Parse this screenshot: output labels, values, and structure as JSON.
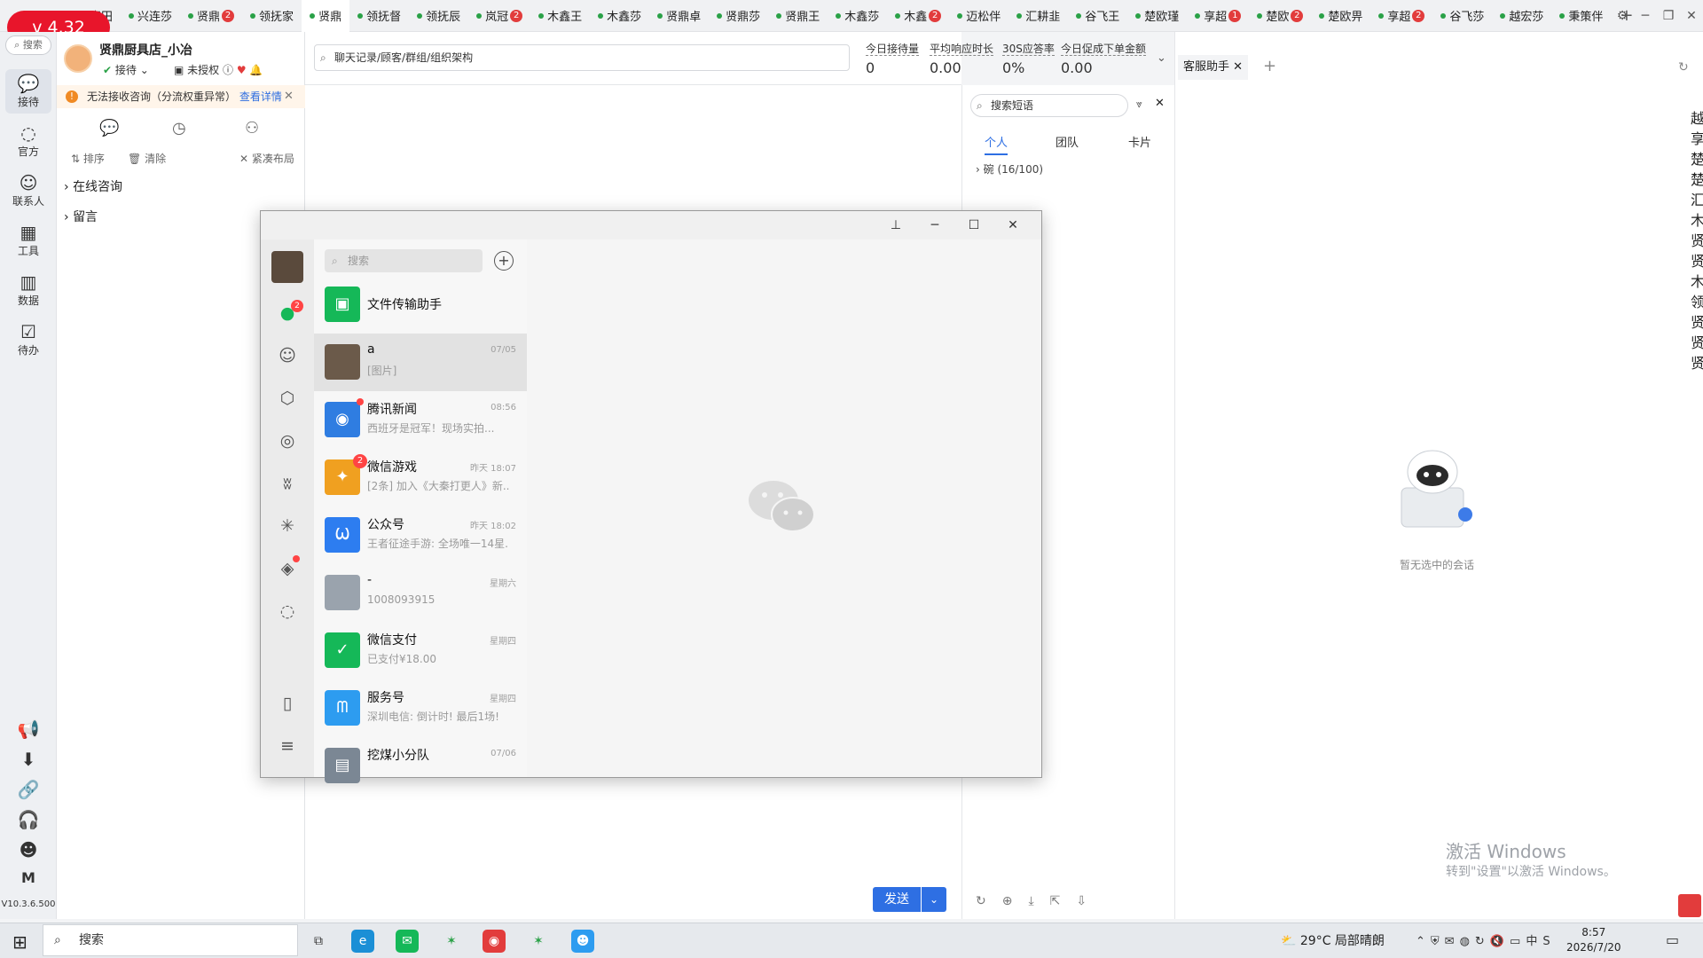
{
  "app": {
    "version_badge": "v 4.32",
    "rail_version": "V10.3.6.500"
  },
  "tabs": [
    {
      "label": "喜田",
      "badge": "",
      "active": false
    },
    {
      "label": "兴连莎",
      "badge": "",
      "active": false
    },
    {
      "label": "贤鼎",
      "badge": "2",
      "active": false
    },
    {
      "label": "领抚家",
      "badge": "",
      "active": false
    },
    {
      "label": "贤鼎",
      "badge": "",
      "active": true
    },
    {
      "label": "领抚督",
      "badge": "",
      "active": false
    },
    {
      "label": "领抚辰",
      "badge": "",
      "active": false
    },
    {
      "label": "岚冠",
      "badge": "2",
      "active": false
    },
    {
      "label": "木鑫王",
      "badge": "",
      "active": false
    },
    {
      "label": "木鑫莎",
      "badge": "",
      "active": false
    },
    {
      "label": "贤鼎卓",
      "badge": "",
      "active": false
    },
    {
      "label": "贤鼎莎",
      "badge": "",
      "active": false
    },
    {
      "label": "贤鼎王",
      "badge": "",
      "active": false
    },
    {
      "label": "木鑫莎",
      "badge": "",
      "active": false
    },
    {
      "label": "木鑫",
      "badge": "2",
      "active": false
    },
    {
      "label": "迈松伴",
      "badge": "",
      "active": false
    },
    {
      "label": "汇耕韭",
      "badge": "",
      "active": false
    },
    {
      "label": "谷飞王",
      "badge": "",
      "active": false
    },
    {
      "label": "楚欧瑾",
      "badge": "",
      "active": false
    },
    {
      "label": "享超",
      "badge": "1",
      "active": false
    },
    {
      "label": "楚欧",
      "badge": "2",
      "active": false
    },
    {
      "label": "楚欧畀",
      "badge": "",
      "active": false
    },
    {
      "label": "享超",
      "badge": "2",
      "active": false
    },
    {
      "label": "谷飞莎",
      "badge": "",
      "active": false
    },
    {
      "label": "越宏莎",
      "badge": "",
      "active": false
    },
    {
      "label": "秉策伴",
      "badge": "",
      "active": false
    }
  ],
  "rail": {
    "search": "搜索",
    "items": [
      "接待",
      "官方",
      "联系人",
      "工具",
      "数据",
      "待办"
    ]
  },
  "left_panel": {
    "shop_name": "贤鼎厨具店_小冶",
    "status": "接待",
    "auth": "未授权",
    "warning": "无法接收咨询（分流权重异常）",
    "warning_link": "查看详情",
    "sort": "排序",
    "clear": "清除",
    "compact": "紧凑布局",
    "groups": [
      "在线咨询",
      "留言"
    ]
  },
  "center": {
    "search_placeholder": "聊天记录/顾客/群组/组织架构",
    "kpis": [
      {
        "label": "今日接待量",
        "value": "0"
      },
      {
        "label": "平均响应时长",
        "value": "0.00"
      },
      {
        "label": "30S应答率",
        "value": "0%"
      },
      {
        "label": "今日促成下单金额",
        "value": "0.00"
      }
    ],
    "send": "发送"
  },
  "phrases": {
    "search_placeholder": "搜索短语",
    "tabs": [
      "个人",
      "团队",
      "卡片"
    ],
    "group": "碗 (16/100)"
  },
  "assistant": {
    "tab": "客服助手",
    "empty": "暂无选中的会话",
    "activate_title": "激活 Windows",
    "activate_sub": "转到\"设置\"以激活 Windows。",
    "right_chars": [
      "越",
      "享",
      "楚",
      "楚",
      "汇",
      "木",
      "贤",
      "贤",
      "木",
      "领",
      "贤",
      "贤",
      "贤"
    ]
  },
  "wechat": {
    "search": "搜索",
    "chat_badge": "2",
    "chats": [
      {
        "name": "文件传输助手",
        "time": "",
        "preview": "",
        "badge": "",
        "color": "#15b858",
        "icon": "folder-icon"
      },
      {
        "name": "a",
        "time": "07/05",
        "preview": "[图片]",
        "badge": "",
        "color": "#6b5a4a",
        "icon": "avatar-photo"
      },
      {
        "name": "腾讯新闻",
        "time": "08:56",
        "preview": "西班牙是冠军！现场实拍...",
        "badge": "dot",
        "color": "#2f7de1",
        "icon": "news-icon"
      },
      {
        "name": "微信游戏",
        "time": "昨天 18:07",
        "preview": "[2条] 加入《大秦打更人》新...",
        "badge": "2",
        "color": "#f0a020",
        "icon": "game-icon"
      },
      {
        "name": "公众号",
        "time": "昨天 18:02",
        "preview": "王者征途手游: 全场唯一14星...",
        "badge": "",
        "color": "#2d7df0",
        "icon": "official-icon"
      },
      {
        "name": "-",
        "time": "星期六",
        "preview": "1008093915",
        "badge": "",
        "color": "#9aa3ad",
        "icon": "avatar-photo"
      },
      {
        "name": "微信支付",
        "time": "星期四",
        "preview": "已支付¥18.00",
        "badge": "",
        "color": "#15b858",
        "icon": "pay-icon"
      },
      {
        "name": "服务号",
        "time": "星期四",
        "preview": "深圳电信: 倒计时! 最后1场!",
        "badge": "",
        "color": "#2d9cf0",
        "icon": "service-icon"
      },
      {
        "name": "挖煤小分队",
        "time": "07/06",
        "preview": "",
        "badge": "",
        "color": "#7b8794",
        "icon": "group-icon"
      }
    ]
  },
  "taskbar": {
    "search": "搜索",
    "weather": "29°C  局部晴朗",
    "time": "8:57",
    "date": "2026/7/20",
    "ime": "中"
  }
}
